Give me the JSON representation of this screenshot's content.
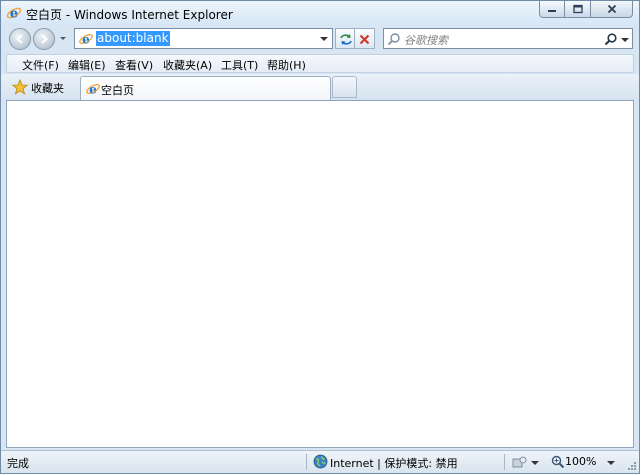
{
  "window": {
    "title": "空白页 - Windows Internet Explorer"
  },
  "nav": {
    "address_url": "about:blank",
    "search_placeholder": "谷歌搜索"
  },
  "menu": {
    "items": [
      {
        "label": "文件(F)"
      },
      {
        "label": "编辑(E)"
      },
      {
        "label": "查看(V)"
      },
      {
        "label": "收藏夹(A)"
      },
      {
        "label": "工具(T)"
      },
      {
        "label": "帮助(H)"
      }
    ]
  },
  "favorites": {
    "label": "收藏夹"
  },
  "tabs": [
    {
      "label": "空白页",
      "active": true
    }
  ],
  "status": {
    "text": "完成",
    "zone": "Internet | 保护模式: 禁用",
    "zoom": "100%"
  },
  "colors": {
    "frame": "#d8e6f3",
    "selection": "#3399ff",
    "ie_blue": "#1c76c9",
    "ie_orange": "#f2a33a"
  },
  "icons": {
    "title": "ie-logo-icon",
    "back": "back-arrow-icon",
    "forward": "forward-arrow-icon",
    "refresh": "refresh-icon",
    "stop": "stop-icon",
    "search": "search-icon",
    "favorites": "star-icon",
    "zone": "globe-icon",
    "zoom": "magnifier-icon"
  }
}
